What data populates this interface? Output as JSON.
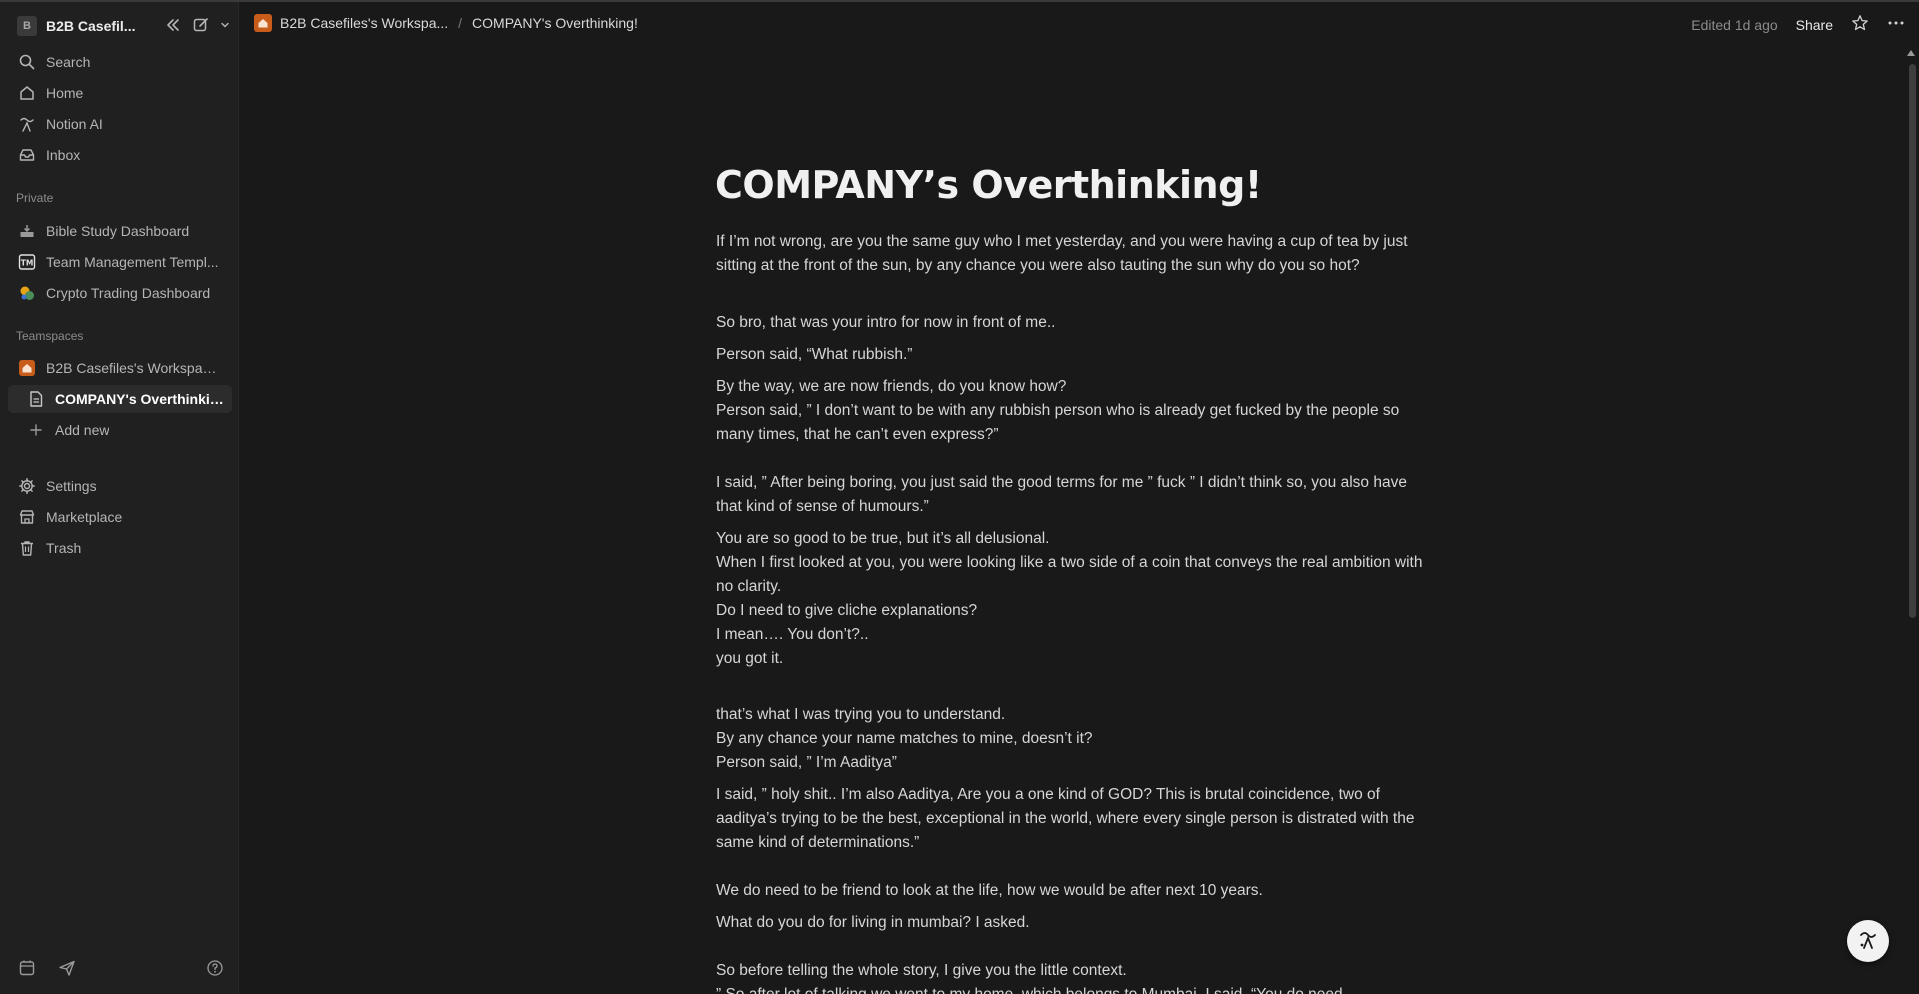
{
  "sidebar": {
    "workspace": {
      "avatar": "B",
      "name": "B2B Casefil..."
    },
    "nav": [
      {
        "label": "Search",
        "icon": "search-icon"
      },
      {
        "label": "Home",
        "icon": "home-icon"
      },
      {
        "label": "Notion AI",
        "icon": "notion-ai-icon"
      },
      {
        "label": "Inbox",
        "icon": "inbox-icon"
      }
    ],
    "private_label": "Private",
    "private_items": [
      {
        "label": "Bible Study Dashboard",
        "icon": "tray-icon"
      },
      {
        "label": "Team Management Templ...",
        "icon": "tm-icon"
      },
      {
        "label": "Crypto Trading Dashboard",
        "icon": "crypto-icon"
      }
    ],
    "teamspaces_label": "Teamspaces",
    "teamspace_items": [
      {
        "label": "B2B Casefiles's Workspac...",
        "icon": "house-icon"
      },
      {
        "label": "COMPANY's Overthinking!",
        "icon": "page-icon"
      },
      {
        "label": "Add new",
        "icon": "plus-icon"
      }
    ],
    "footer_items": [
      {
        "label": "Settings",
        "icon": "gear-icon"
      },
      {
        "label": "Marketplace",
        "icon": "marketplace-icon"
      },
      {
        "label": "Trash",
        "icon": "trash-icon"
      }
    ]
  },
  "topbar": {
    "breadcrumb_workspace": "B2B Casefiles's Workspa...",
    "breadcrumb_sep": "/",
    "breadcrumb_page": "COMPANY's Overthinking!",
    "edited": "Edited 1d ago",
    "share": "Share"
  },
  "page": {
    "title": "COMPANY’s Overthinking!",
    "paragraphs": [
      "If I’m not wrong, are you the same guy who I met yesterday, and you were having a cup of tea by just sitting at the front of the sun, by any chance you were also tauting the sun why do you so hot?",
      "So bro, that was your intro for now in front of me..",
      "Person said, “What rubbish.”",
      "By the way, we are now friends, do you know how?",
      "Person said, ” I don’t want to be with any rubbish person who is already get fucked by the people so many times, that he can’t even express?”",
      "I said, ” After being boring, you just said the good terms for me ” fuck ” I didn’t think so, you also have that kind of sense of humours.”",
      "You are so good to be true, but it’s all delusional.",
      "When I first looked at you, you were looking like a two side of a coin that conveys the real ambition with no clarity.",
      "Do I need to give cliche explanations?",
      "I mean…. You don’t?..",
      "you got it.",
      "that’s what I was trying you to understand.",
      "By any chance your name matches to mine, doesn’t it?",
      "Person said, ” I’m Aaditya”",
      "I said, ” holy shit.. I’m also Aaditya, Are you a one kind of GOD? This is brutal coincidence, two of aaditya’s trying to be the best, exceptional in the world, where every single person is distrated with the same kind of determinations.”",
      "We do need to be friend to look at the life, how we would be after next 10 years.",
      "What do you do for living in mumbai? I asked.",
      "So before telling the whole story, I give you the little context.",
      "” So after lot of talking we went to my home, which belongs to Mumbai, I said, “You do need"
    ]
  }
}
